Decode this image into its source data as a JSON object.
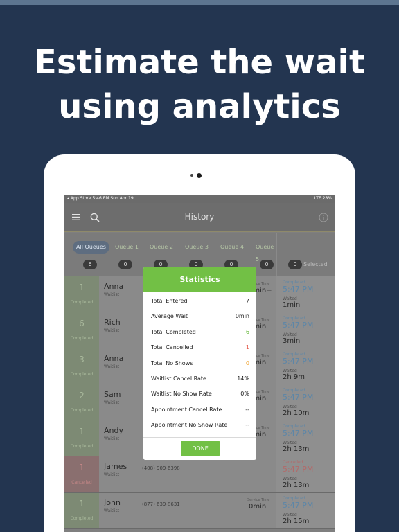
{
  "headline": {
    "line1": "Estimate the wait",
    "line2": "using analytics"
  },
  "status_bar": {
    "left": "◂ App Store  5:46 PM  Sun Apr 19",
    "right": "LTE 28%"
  },
  "nav": {
    "title": "History"
  },
  "queues": {
    "tabs": [
      {
        "label": "All Queues",
        "count": "6"
      },
      {
        "label": "Queue 1",
        "count": "0"
      },
      {
        "label": "Queue 2",
        "count": "0"
      },
      {
        "label": "Queue 3",
        "count": "0"
      },
      {
        "label": "Queue 4",
        "count": "0"
      },
      {
        "label": "Queue 5",
        "count": "0"
      }
    ],
    "selected_count": "0",
    "selected_label": "Selected"
  },
  "rows": [
    {
      "pos": "1",
      "state": "Completed",
      "name": "Anna",
      "sub": "Waitlist",
      "phone": "",
      "svc_label": "Service Time",
      "svc": "5min+",
      "rc_state": "Completed",
      "time": "5:47 PM",
      "wait_label": "Waited",
      "wait": "1min"
    },
    {
      "pos": "6",
      "state": "Completed",
      "name": "Rich",
      "sub": "Waitlist",
      "phone": "",
      "svc_label": "Service Time",
      "svc": "0min",
      "rc_state": "Completed",
      "time": "5:47 PM",
      "wait_label": "Waited",
      "wait": "3min"
    },
    {
      "pos": "3",
      "state": "Completed",
      "name": "Anna",
      "sub": "Waitlist",
      "phone": "",
      "svc_label": "Service Time",
      "svc": "0min",
      "rc_state": "Completed",
      "time": "5:47 PM",
      "wait_label": "Waited",
      "wait": "2h 9m"
    },
    {
      "pos": "2",
      "state": "Completed",
      "name": "Sam",
      "sub": "Waitlist",
      "phone": "",
      "svc_label": "Service Time",
      "svc": "0min",
      "rc_state": "Completed",
      "time": "5:47 PM",
      "wait_label": "Waited",
      "wait": "2h 10m"
    },
    {
      "pos": "1",
      "state": "Completed",
      "name": "Andy",
      "sub": "Waitlist",
      "phone": "",
      "svc_label": "Service Time",
      "svc": "0min",
      "rc_state": "Completed",
      "time": "5:47 PM",
      "wait_label": "Waited",
      "wait": "2h 13m"
    },
    {
      "pos": "1",
      "state": "Cancelled",
      "name": "James",
      "sub": "Waitlist",
      "phone": "(408) 909-6398",
      "svc_label": "",
      "svc": "",
      "rc_state": "Cancelled",
      "time": "5:47 PM",
      "wait_label": "Waited",
      "wait": "2h 13m"
    },
    {
      "pos": "1",
      "state": "Completed",
      "name": "John",
      "sub": "Waitlist",
      "phone": "(877) 639-8631",
      "svc_label": "Service Time",
      "svc": "0min",
      "rc_state": "Completed",
      "time": "5:47 PM",
      "wait_label": "Waited",
      "wait": "2h 15m"
    }
  ],
  "modal": {
    "title": "Statistics",
    "stats": [
      {
        "label": "Total Entered",
        "value": "7",
        "tone": ""
      },
      {
        "label": "Average Wait",
        "value": "0min",
        "tone": ""
      },
      {
        "label": "Total Completed",
        "value": "6",
        "tone": "green"
      },
      {
        "label": "Total Cancelled",
        "value": "1",
        "tone": "red"
      },
      {
        "label": "Total No Shows",
        "value": "0",
        "tone": "orange"
      },
      {
        "label": "Waitlist Cancel Rate",
        "value": "14%",
        "tone": ""
      },
      {
        "label": "Waitlist No Show Rate",
        "value": "0%",
        "tone": ""
      },
      {
        "label": "Appointment Cancel Rate",
        "value": "--",
        "tone": ""
      },
      {
        "label": "Appointment No Show Rate",
        "value": "--",
        "tone": ""
      }
    ],
    "done_label": "DONE"
  },
  "colors": {
    "background": "#233550",
    "accent_green": "#72c045",
    "cancel_red": "#e4594a",
    "noshow_orange": "#f0a029"
  }
}
